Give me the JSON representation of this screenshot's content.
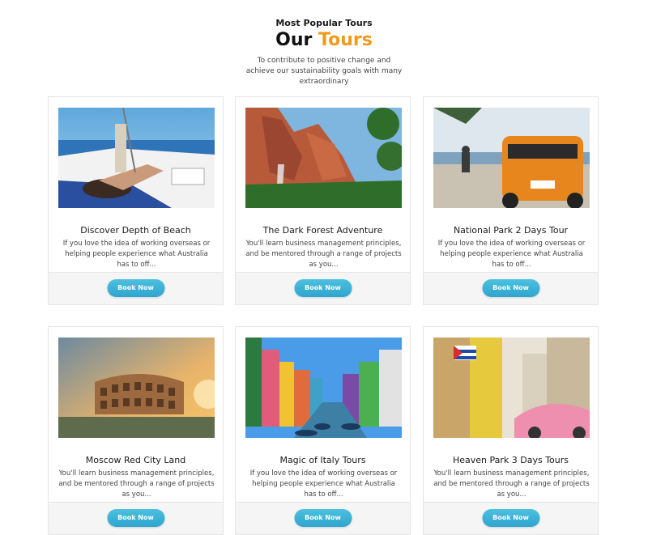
{
  "header": {
    "eyebrow": "Most Popular Tours",
    "title_main": "Our",
    "title_accent": "Tours",
    "subtitle": "To contribute to positive change and achieve our sustainability goals with many extraordinary"
  },
  "colors": {
    "accent": "#f29a1c",
    "button": "#3fb4d8"
  },
  "tours": [
    {
      "name": "Discover Depth of Beach",
      "desc": "If you love the idea of working overseas or helping people experience what Australia has to off...",
      "button": "Book Now"
    },
    {
      "name": "The Dark Forest Adventure",
      "desc": "You'll learn business management principles, and be mentored through a range of projects as you...",
      "button": "Book Now"
    },
    {
      "name": "National Park 2 Days Tour",
      "desc": "If you love the idea of working overseas or helping people experience what Australia has to off...",
      "button": "Book Now"
    },
    {
      "name": "Moscow Red City Land",
      "desc": "You'll learn business management principles, and be mentored through a range of projects as you...",
      "button": "Book Now"
    },
    {
      "name": "Magic of Italy Tours",
      "desc": "If you love the idea of working overseas or helping people experience what Australia has to off...",
      "button": "Book Now"
    },
    {
      "name": "Heaven Park 3 Days Tours",
      "desc": "You'll learn business management principles, and be mentored through a range of projects as you...",
      "button": "Book Now"
    }
  ]
}
